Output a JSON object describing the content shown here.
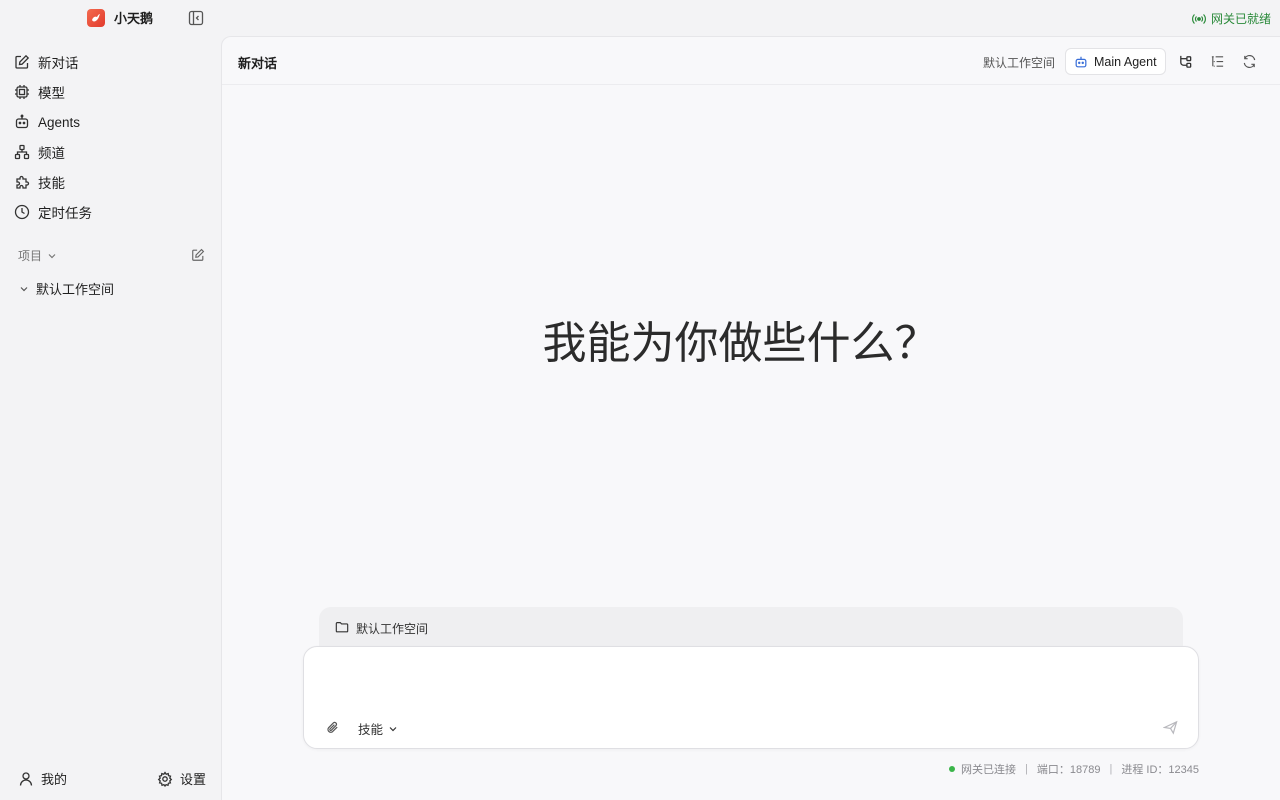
{
  "app": {
    "name": "小天鹅",
    "logo_color": "#e8472f",
    "gateway_status": "网关已就绪",
    "gateway_status_color": "#2a8a3a"
  },
  "sidebar": {
    "items": [
      {
        "label": "新对话",
        "icon": "edit-icon"
      },
      {
        "label": "模型",
        "icon": "chip-icon"
      },
      {
        "label": "Agents",
        "icon": "bot-icon"
      },
      {
        "label": "频道",
        "icon": "network-icon"
      },
      {
        "label": "技能",
        "icon": "puzzle-icon"
      },
      {
        "label": "定时任务",
        "icon": "clock-icon"
      }
    ],
    "projects_label": "项目",
    "projects": [
      {
        "label": "默认工作空间"
      }
    ],
    "bottom": {
      "profile_label": "我的",
      "settings_label": "设置"
    }
  },
  "main": {
    "title": "新对话",
    "workspace_label": "默认工作空间",
    "agent_label": "Main Agent",
    "hero_text": "我能为你做些什么？",
    "composer": {
      "workspace_chip": "默认工作空间",
      "placeholder": "",
      "skills_label": "技能"
    },
    "footer": {
      "connection": "网关已连接",
      "port": "端口：18789",
      "pid": "进程 ID：12345",
      "dot_color": "#3bb54a"
    }
  }
}
